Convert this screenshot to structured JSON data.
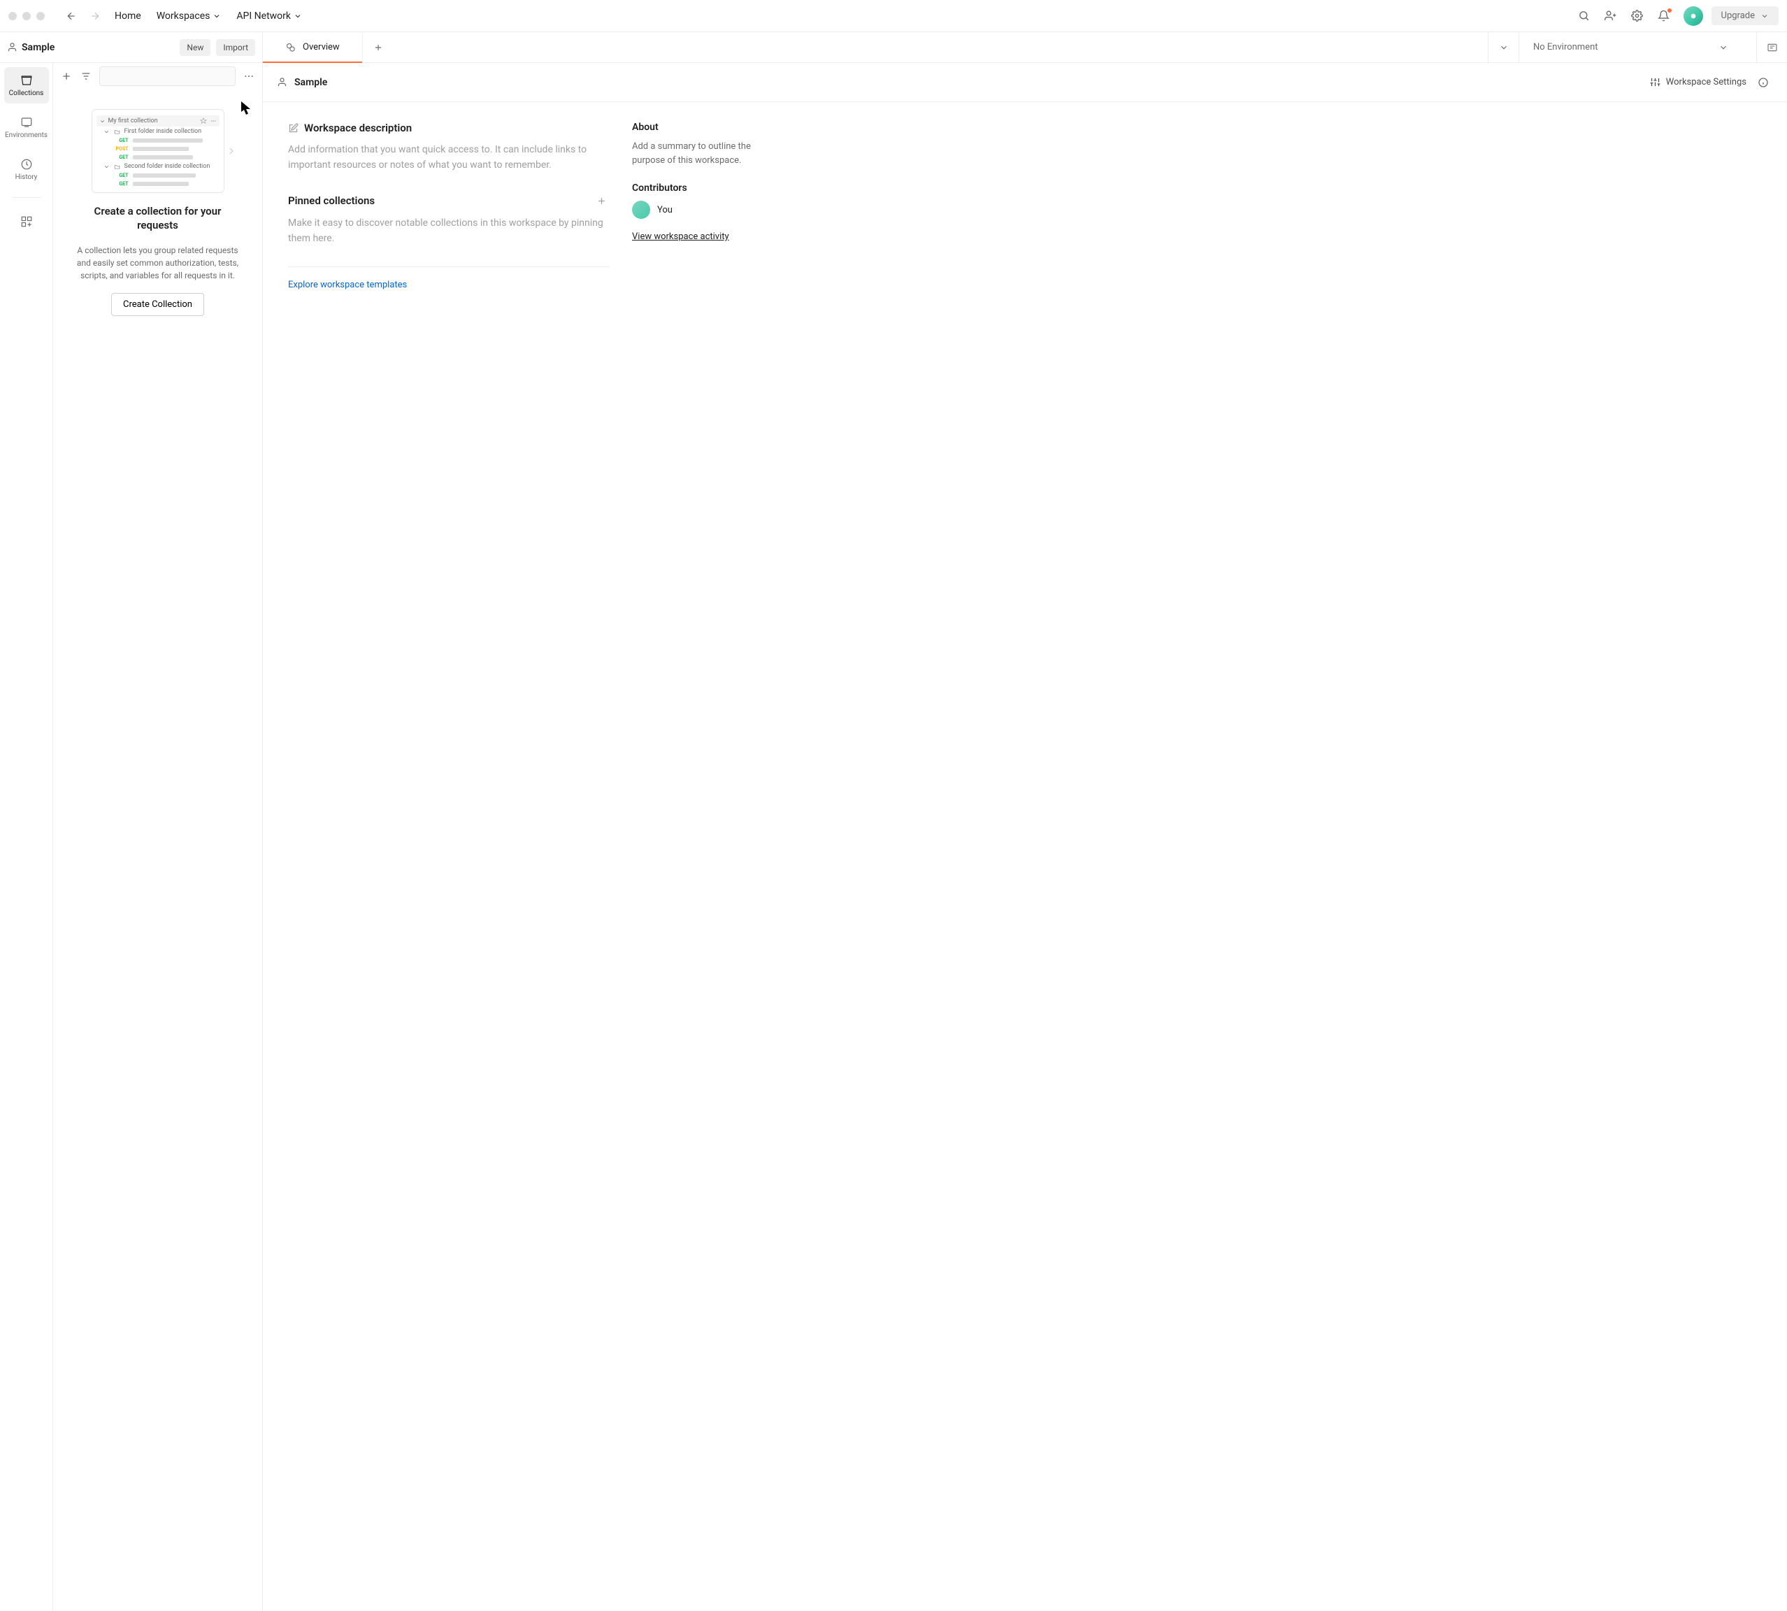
{
  "topbar": {
    "home": "Home",
    "workspaces": "Workspaces",
    "api_network": "API Network",
    "upgrade": "Upgrade"
  },
  "sidebar": {
    "workspace_name": "Sample",
    "new_btn": "New",
    "import_btn": "Import",
    "rail": {
      "collections": "Collections",
      "environments": "Environments",
      "history": "History"
    },
    "illustration": {
      "collection_name": "My first collection",
      "folder1": "First folder inside collection",
      "folder2": "Second folder inside collection",
      "get": "GET",
      "post": "POST"
    },
    "empty_title": "Create a collection for your requests",
    "empty_desc": "A collection lets you group related requests and easily set common authorization, tests, scripts, and variables for all requests in it.",
    "create_btn": "Create Collection"
  },
  "tabs": {
    "overview": "Overview",
    "no_environment": "No Environment"
  },
  "main": {
    "workspace_name": "Sample",
    "workspace_settings": "Workspace Settings",
    "desc_title": "Workspace description",
    "desc_placeholder": "Add information that you want quick access to. It can include links to important resources or notes of what you want to remember.",
    "pinned_title": "Pinned collections",
    "pinned_placeholder": "Make it easy to discover notable collections in this workspace by pinning them here.",
    "explore_link": "Explore workspace templates"
  },
  "about": {
    "title": "About",
    "placeholder": "Add a summary to outline the purpose of this workspace.",
    "contributors_title": "Contributors",
    "you": "You",
    "activity_link": "View workspace activity"
  }
}
